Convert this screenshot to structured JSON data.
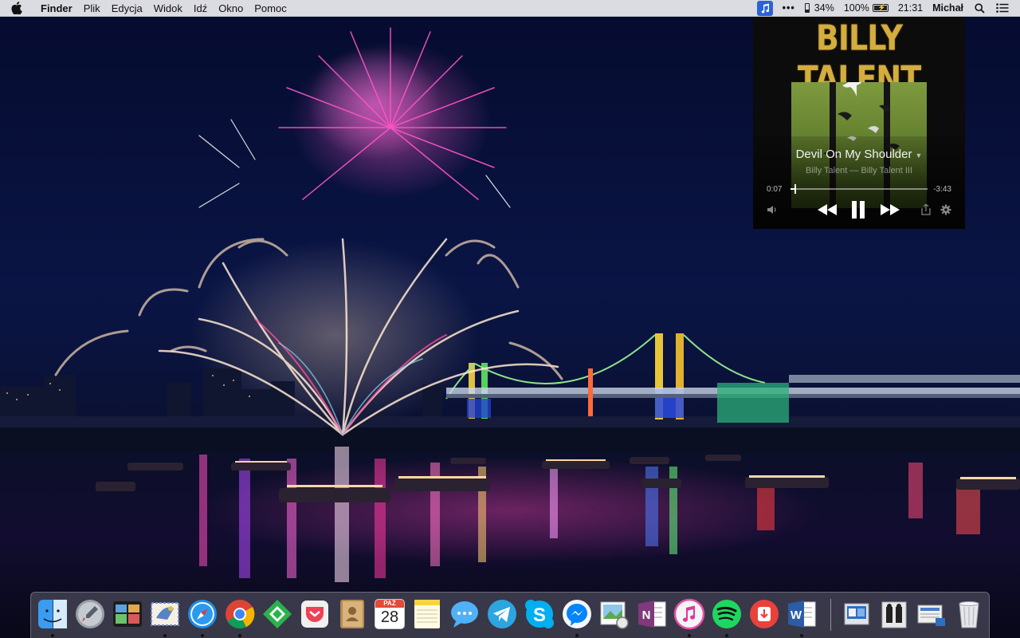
{
  "menubar": {
    "apple_icon": "apple-logo-icon",
    "app_name": "Finder",
    "menus": [
      "Plik",
      "Edycja",
      "Widok",
      "Idź",
      "Okno",
      "Pomoc"
    ],
    "status": {
      "music_icon": "music-note-icon",
      "more_icon": "ellipsis-icon",
      "phone_battery_icon": "phone-battery-icon",
      "phone_battery": "34%",
      "battery_percent": "100%",
      "battery_icon": "battery-charging-icon",
      "clock": "21:31",
      "user": "Michał",
      "search_icon": "spotlight-icon",
      "notifications_icon": "notification-center-icon"
    }
  },
  "player": {
    "band_logo": "BILLY TALENT",
    "song_title": "Devil On My Shoulder",
    "artist_album": "Billy Talent — Billy Talent III",
    "elapsed": "0:07",
    "remaining": "-3:43",
    "progress": 0.03,
    "controls": [
      "volume-icon",
      "rewind-icon",
      "pause-icon",
      "fast-forward-icon",
      "share-icon",
      "settings-icon"
    ]
  },
  "dock": {
    "apps": [
      {
        "name": "finder",
        "icon": "finder-icon",
        "running": true
      },
      {
        "name": "launchpad",
        "icon": "launchpad-icon",
        "running": false
      },
      {
        "name": "mission-control",
        "icon": "mission-control-icon",
        "running": false
      },
      {
        "name": "mail",
        "icon": "mail-icon",
        "running": true
      },
      {
        "name": "safari",
        "icon": "safari-icon",
        "running": true
      },
      {
        "name": "chrome",
        "icon": "chrome-icon",
        "running": true
      },
      {
        "name": "feedly",
        "icon": "feedly-icon",
        "running": false
      },
      {
        "name": "pocket",
        "icon": "pocket-icon",
        "running": false
      },
      {
        "name": "contacts",
        "icon": "contacts-icon",
        "running": false
      },
      {
        "name": "calendar",
        "icon": "calendar-icon",
        "running": false
      },
      {
        "name": "notes",
        "icon": "notes-icon",
        "running": false
      },
      {
        "name": "messages",
        "icon": "messages-icon",
        "running": false
      },
      {
        "name": "telegram",
        "icon": "telegram-icon",
        "running": false
      },
      {
        "name": "skype",
        "icon": "skype-icon",
        "running": false
      },
      {
        "name": "messenger",
        "icon": "messenger-icon",
        "running": true
      },
      {
        "name": "preview",
        "icon": "preview-icon",
        "running": false
      },
      {
        "name": "onenote",
        "icon": "onenote-icon",
        "running": false
      },
      {
        "name": "itunes",
        "icon": "itunes-icon",
        "running": true
      },
      {
        "name": "spotify",
        "icon": "spotify-icon",
        "running": true
      },
      {
        "name": "downie",
        "icon": "downloader-icon",
        "running": false
      },
      {
        "name": "word",
        "icon": "word-icon",
        "running": true
      }
    ],
    "calendar_month": "PAŹ",
    "calendar_day": "28",
    "stacks": [
      {
        "name": "stack-documents",
        "icon": "documents-stack-icon"
      },
      {
        "name": "stack-downloads",
        "icon": "downloads-stack-icon"
      },
      {
        "name": "stack-screenshots",
        "icon": "screenshots-stack-icon"
      },
      {
        "name": "trash",
        "icon": "trash-icon"
      }
    ]
  }
}
